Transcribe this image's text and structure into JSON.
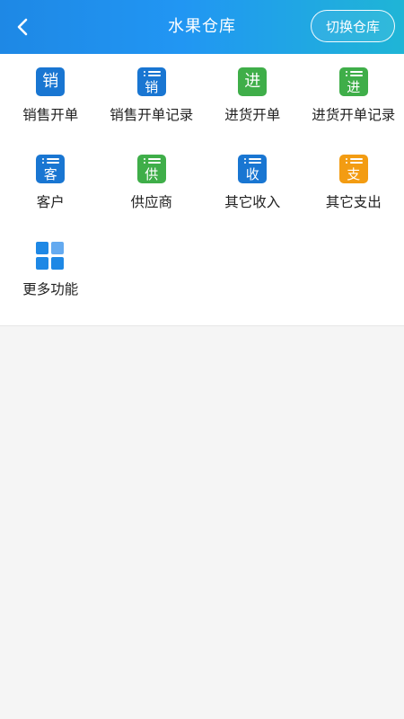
{
  "header": {
    "title": "水果仓库",
    "switch_label": "切换仓库"
  },
  "colors": {
    "header_gradient_start": "#1e88e5",
    "header_gradient_end": "#1fb5d6",
    "blue": "#1976d2",
    "green": "#3fae49",
    "orange": "#f39c12"
  },
  "menu": [
    {
      "label": "销售开单",
      "glyph": "销",
      "color": "blue",
      "icon": "sales-order-icon"
    },
    {
      "label": "销售开单记录",
      "glyph": "销",
      "color": "blue",
      "icon": "sales-record-icon"
    },
    {
      "label": "进货开单",
      "glyph": "进",
      "color": "green",
      "icon": "purchase-order-icon"
    },
    {
      "label": "进货开单记录",
      "glyph": "进",
      "color": "green",
      "icon": "purchase-record-icon"
    },
    {
      "label": "客户",
      "glyph": "客",
      "color": "blue",
      "icon": "customer-icon"
    },
    {
      "label": "供应商",
      "glyph": "供",
      "color": "green",
      "icon": "supplier-icon"
    },
    {
      "label": "其它收入",
      "glyph": "收",
      "color": "blue",
      "icon": "other-income-icon"
    },
    {
      "label": "其它支出",
      "glyph": "支",
      "color": "orange",
      "icon": "other-expense-icon"
    },
    {
      "label": "更多功能",
      "icon": "more-grid-icon"
    }
  ]
}
